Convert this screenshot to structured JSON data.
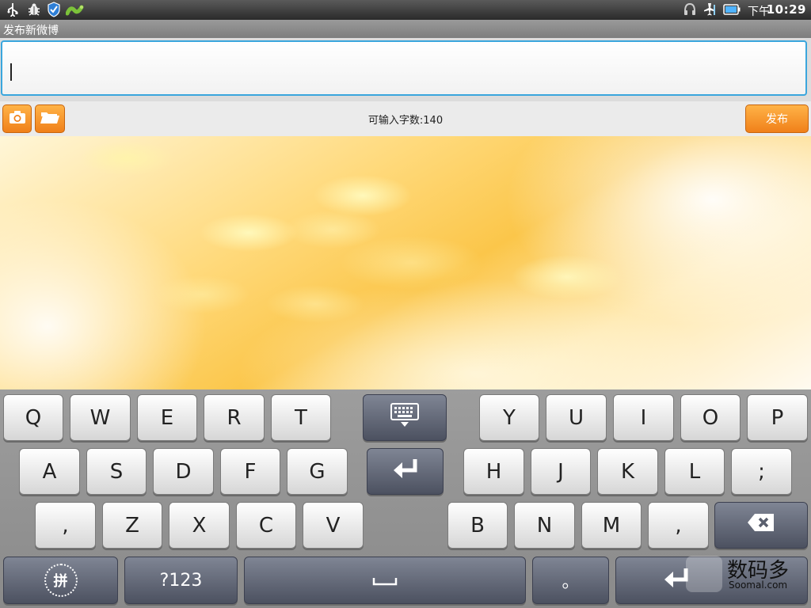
{
  "status_bar": {
    "ampm": "下午",
    "time": "10:29",
    "icons": [
      "usb-icon",
      "debug-bug-icon",
      "shield-check-icon",
      "app-worm-icon",
      "headset-icon",
      "airplane-signal-icon",
      "battery-icon"
    ]
  },
  "title_bar": {
    "title": "发布新微博"
  },
  "compose": {
    "text_value": "",
    "char_count_label": "可输入字数:140",
    "publish_label": "发布"
  },
  "keyboard": {
    "row1": [
      "Q",
      "W",
      "E",
      "R",
      "T",
      "Y",
      "U",
      "I",
      "O",
      "P"
    ],
    "row2": [
      "A",
      "S",
      "D",
      "F",
      "G",
      "H",
      "J",
      "K",
      "L",
      ";"
    ],
    "row3": [
      ",",
      "Z",
      "X",
      "C",
      "V",
      "B",
      "N",
      "M",
      ","
    ],
    "row4": {
      "pinyin_label": "拼",
      "symbols_label": "?123",
      "period_label": "。"
    }
  },
  "watermark": {
    "text": "数码多",
    "url_text": "Soomal.com"
  },
  "colors": {
    "accent_orange": "#f0801a",
    "input_border": "#3aa6dd",
    "dark_key": "#5a5f6e"
  }
}
